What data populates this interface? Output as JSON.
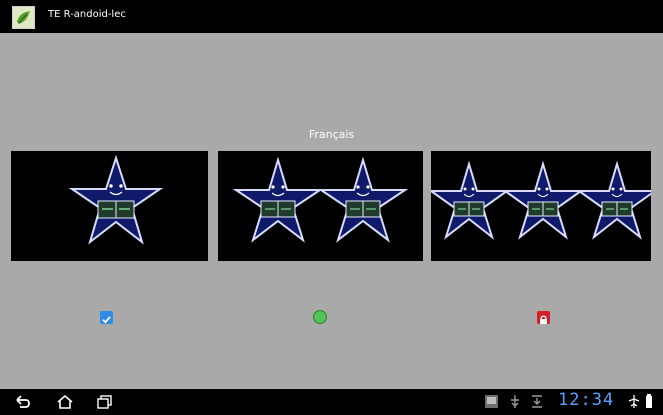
{
  "app": {
    "title": "TE R-andoid-lec"
  },
  "main": {
    "language_label": "Français",
    "cards": [
      {
        "name": "one-star-card",
        "stars": 1
      },
      {
        "name": "two-star-card",
        "stars": 2
      },
      {
        "name": "three-star-card",
        "stars": 3
      }
    ],
    "status": [
      {
        "name": "selected-checkbox-icon",
        "state": "checked"
      },
      {
        "name": "green-circle-icon",
        "state": "available"
      },
      {
        "name": "red-lock-icon",
        "state": "locked"
      }
    ]
  },
  "system_bar": {
    "time": "12:34",
    "icons": [
      "back-icon",
      "home-icon",
      "recent-apps-icon",
      "gallery-icon",
      "usb-icon",
      "download-icon",
      "airplane-icon",
      "battery-icon"
    ]
  },
  "colors": {
    "top_bar": "#000000",
    "content_bg": "#a9a9a9",
    "checkbox": "#2e8ce6",
    "circle": "#56c156",
    "lock": "#d31f25",
    "clock": "#5aa0ff"
  }
}
